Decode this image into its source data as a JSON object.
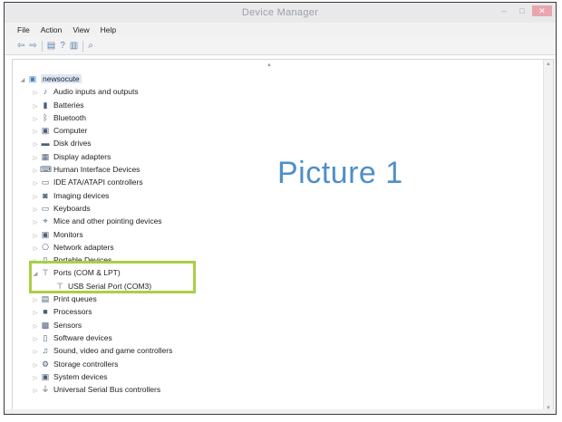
{
  "window": {
    "title": "Device Manager",
    "controls": [
      "–",
      "□",
      "✕"
    ]
  },
  "menu": [
    "File",
    "Action",
    "View",
    "Help"
  ],
  "toolbar": [
    {
      "name": "back-icon",
      "glyph": "⇦"
    },
    {
      "name": "forward-icon",
      "glyph": "⇨"
    },
    {
      "name": "properties-icon",
      "glyph": "▤"
    },
    {
      "name": "help-icon",
      "glyph": "?"
    },
    {
      "name": "view-icon",
      "glyph": "▥"
    },
    {
      "name": "scan-icon",
      "glyph": "⌕"
    }
  ],
  "tree": {
    "root": "newsocute",
    "items": [
      {
        "label": "Audio inputs and outputs",
        "icon": "speaker-icon",
        "glyph": "♪",
        "expanded": false
      },
      {
        "label": "Batteries",
        "icon": "battery-icon",
        "glyph": "▮",
        "expanded": false
      },
      {
        "label": "Bluetooth",
        "icon": "bluetooth-icon",
        "glyph": "ᛒ",
        "expanded": false
      },
      {
        "label": "Computer",
        "icon": "computer-icon",
        "glyph": "▣",
        "expanded": false
      },
      {
        "label": "Disk drives",
        "icon": "disk-icon",
        "glyph": "▬",
        "expanded": false
      },
      {
        "label": "Display adapters",
        "icon": "display-icon",
        "glyph": "▦",
        "expanded": false
      },
      {
        "label": "Human Interface Devices",
        "icon": "hid-icon",
        "glyph": "⌨",
        "expanded": false
      },
      {
        "label": "IDE ATA/ATAPI controllers",
        "icon": "ide-icon",
        "glyph": "▭",
        "expanded": false
      },
      {
        "label": "Imaging devices",
        "icon": "camera-icon",
        "glyph": "◙",
        "expanded": false
      },
      {
        "label": "Keyboards",
        "icon": "keyboard-icon",
        "glyph": "▭",
        "expanded": false
      },
      {
        "label": "Mice and other pointing devices",
        "icon": "mouse-icon",
        "glyph": "⌖",
        "expanded": false
      },
      {
        "label": "Monitors",
        "icon": "monitor-icon",
        "glyph": "▣",
        "expanded": false
      },
      {
        "label": "Network adapters",
        "icon": "network-icon",
        "glyph": "⎔",
        "expanded": false
      },
      {
        "label": "Portable Devices",
        "icon": "portable-icon",
        "glyph": "▯",
        "expanded": false
      },
      {
        "label": "Ports (COM & LPT)",
        "icon": "port-icon",
        "glyph": "⊤",
        "expanded": true
      },
      {
        "label": "USB Serial Port (COM3)",
        "icon": "port-icon",
        "glyph": "⊤",
        "child": true
      },
      {
        "label": "Print queues",
        "icon": "printer-icon",
        "glyph": "▤",
        "expanded": false
      },
      {
        "label": "Processors",
        "icon": "cpu-icon",
        "glyph": "■",
        "expanded": false
      },
      {
        "label": "Sensors",
        "icon": "sensor-icon",
        "glyph": "▩",
        "expanded": false
      },
      {
        "label": "Software devices",
        "icon": "software-icon",
        "glyph": "▯",
        "expanded": false
      },
      {
        "label": "Sound, video and game controllers",
        "icon": "sound-icon",
        "glyph": "♫",
        "expanded": false
      },
      {
        "label": "Storage controllers",
        "icon": "storage-icon",
        "glyph": "⚙",
        "expanded": false
      },
      {
        "label": "System devices",
        "icon": "system-icon",
        "glyph": "▣",
        "expanded": false
      },
      {
        "label": "Universal Serial Bus controllers",
        "icon": "usb-icon",
        "glyph": "⏚",
        "expanded": false
      }
    ]
  },
  "annotation": {
    "text": "Picture 1",
    "highlight_color": "#a9cf44",
    "text_color": "#4f8fc8"
  }
}
